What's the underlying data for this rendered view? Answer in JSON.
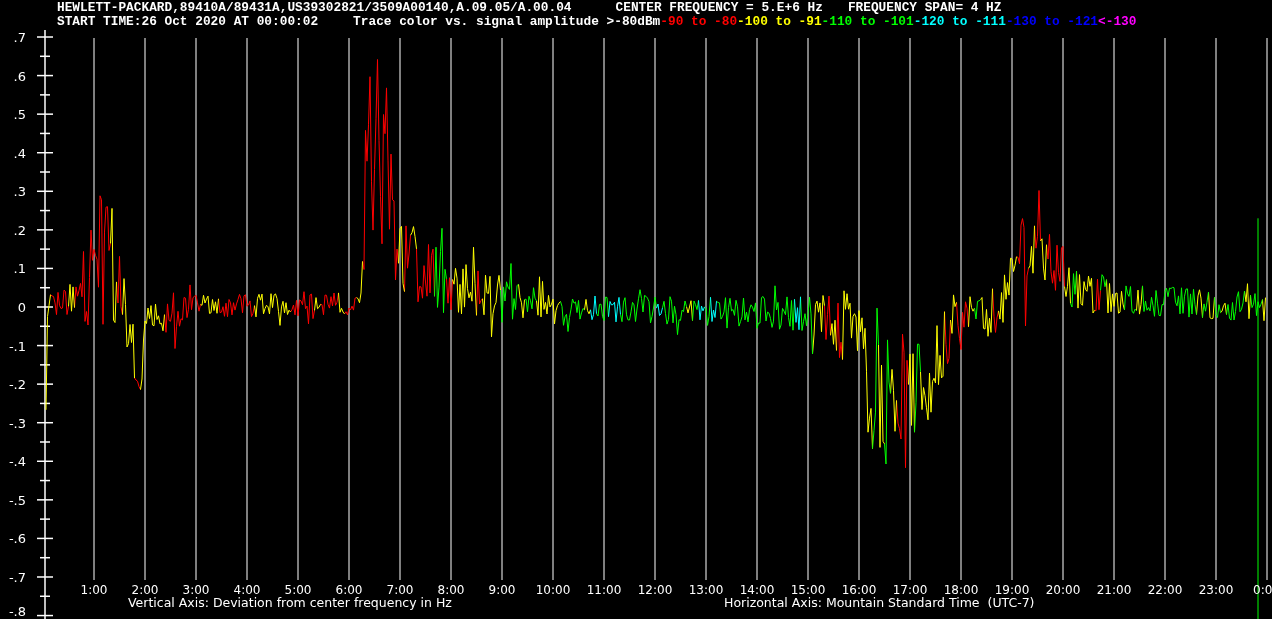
{
  "header": {
    "instrument": "HEWLETT-PACKARD,89410A/89431A,US39302821/3509A00140,A.09.05/A.00.04",
    "center_frequency": "CENTER FREQUENCY = 5.E+6 Hz",
    "frequency_span": "FREQUENCY SPAN= 4 HZ",
    "start_time": "START TIME:26 Oct 2020 AT 00:00:02",
    "legend_title": "Trace color vs. signal amplitude >-80dBm",
    "legend": [
      {
        "label": "-90 to -80",
        "color": "#ff0000"
      },
      {
        "label": "-100 to -91",
        "color": "#ffff00"
      },
      {
        "label": "-110 to -101",
        "color": "#00ff00"
      },
      {
        "label": "-120 to -111",
        "color": "#00ffff"
      },
      {
        "label": "-130 to -121",
        "color": "#0000ff"
      },
      {
        "label": "<-130",
        "color": "#ff00ff"
      }
    ]
  },
  "plot": {
    "y_labels": [
      ".7",
      ".6",
      ".5",
      ".4",
      ".3",
      ".2",
      ".1",
      "0",
      "-.1",
      "-.2",
      "-.3",
      "-.4",
      "-.5",
      "-.6",
      "-.7",
      "-.8"
    ],
    "x_labels": [
      "1:00",
      "2:00",
      "3:00",
      "4:00",
      "5:00",
      "6:00",
      "7:00",
      "8:00",
      "9:00",
      "10:00",
      "11:00",
      "12:00",
      "13:00",
      "14:00",
      "15:00",
      "16:00",
      "17:00",
      "18:00",
      "19:00",
      "20:00",
      "21:00",
      "22:00",
      "23:00",
      "0:0"
    ],
    "vertical_axis_title": "Vertical Axis: Deviation from center frequency in Hz",
    "horizontal_axis_title": "Horizontal Axis: Mountain Standard Time  (UTC-7)"
  }
}
